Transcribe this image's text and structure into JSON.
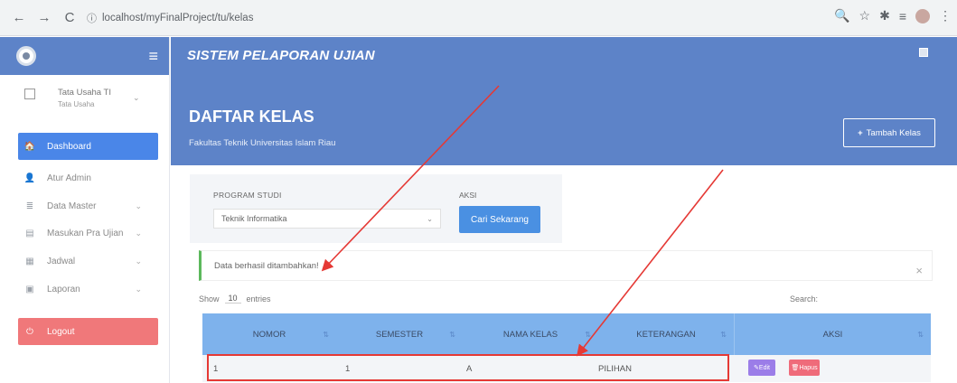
{
  "browser": {
    "back": "←",
    "forward": "→",
    "reload": "C",
    "info": "ⓘ",
    "url": "localhost/myFinalProject/tu/kelas",
    "zoom": "🔍",
    "star": "☆",
    "extension": "✱",
    "playlist": "≡",
    "menu": "⋮"
  },
  "app": {
    "title": "SISTEM PELAPORAN UJIAN"
  },
  "user": {
    "name": "Tata Usaha TI",
    "role": "Tata Usaha"
  },
  "sidebar": {
    "items": [
      {
        "label": "Dashboard",
        "icon": "home-icon",
        "glyph": "🏠"
      },
      {
        "label": "Atur Admin",
        "icon": "user-icon",
        "glyph": "👤"
      },
      {
        "label": "Data Master",
        "icon": "database-icon",
        "glyph": "≣"
      },
      {
        "label": "Masukan Pra Ujian",
        "icon": "form-icon",
        "glyph": "▤"
      },
      {
        "label": "Jadwal",
        "icon": "calendar-icon",
        "glyph": "▦"
      },
      {
        "label": "Laporan",
        "icon": "report-icon",
        "glyph": "▣"
      },
      {
        "label": "Logout",
        "icon": "power-icon",
        "glyph": "⏻"
      }
    ]
  },
  "header": {
    "page_title": "DAFTAR KELAS",
    "subtitle": "Fakultas Teknik Universitas Islam Riau",
    "add_button": "Tambah Kelas"
  },
  "filter": {
    "prodi_label": "PROGRAM STUDI",
    "prodi_value": "Teknik Informatika",
    "aksi_label": "AKSI",
    "search_button": "Cari Sekarang"
  },
  "alert": {
    "message": "Data berhasil ditambahkan!",
    "close": "×"
  },
  "table_controls": {
    "show": "Show",
    "entries_value": "10",
    "entries": "entries",
    "search": "Search:"
  },
  "table": {
    "columns": [
      "NOMOR",
      "SEMESTER",
      "NAMA KELAS",
      "KETERANGAN",
      "AKSI"
    ],
    "rows": [
      {
        "nomor": "1",
        "semester": "1",
        "nama_kelas": "A",
        "keterangan": "PILIHAN"
      }
    ],
    "edit": "Edit",
    "delete": "Hapus"
  },
  "colors": {
    "primary": "#5d83c8",
    "active": "#4a86e8",
    "logout": "#f0787a",
    "table_header": "#7eb2ec",
    "annotation": "#e53935"
  }
}
